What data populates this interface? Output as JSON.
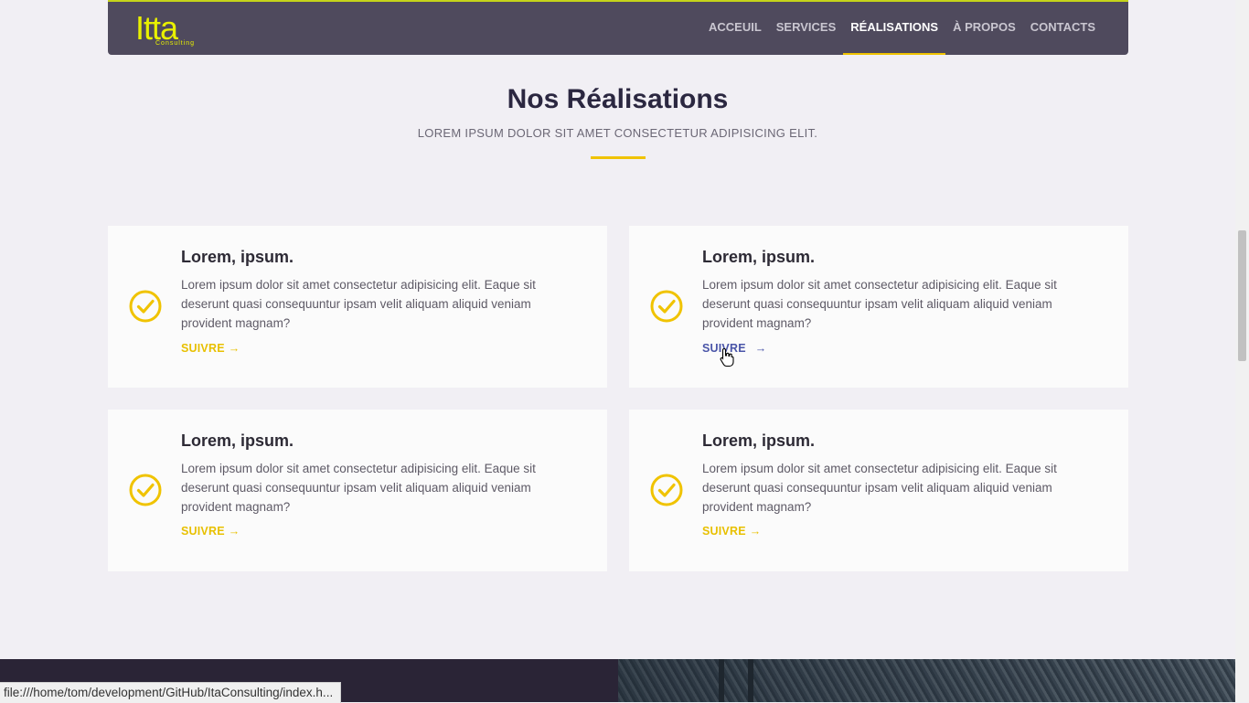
{
  "brand": {
    "logo_text": "Itta",
    "logo_sub": "Consulting"
  },
  "nav": {
    "items": [
      {
        "label": "ACCEUIL",
        "active": false
      },
      {
        "label": "SERVICES",
        "active": false
      },
      {
        "label": "RÉALISATIONS",
        "active": true
      },
      {
        "label": "À PROPOS",
        "active": false
      },
      {
        "label": "CONTACTS",
        "active": false
      }
    ]
  },
  "section": {
    "title": "Nos Réalisations",
    "subtitle": "LOREM IPSUM DOLOR SIT AMET CONSECTETUR ADIPISICING ELIT."
  },
  "cards": [
    {
      "title": "Lorem, ipsum.",
      "text": "Lorem ipsum dolor sit amet consectetur adipisicing elit. Eaque sit deserunt quasi consequuntur ipsam velit aliquam aliquid veniam provident magnam?",
      "link": "SUIVRE",
      "link_arrow": "→",
      "icon": "check-circle-icon"
    },
    {
      "title": "Lorem, ipsum.",
      "text": "Lorem ipsum dolor sit amet consectetur adipisicing elit. Eaque sit deserunt quasi consequuntur ipsam velit aliquam aliquid veniam provident magnam?",
      "link": "SUIVRE",
      "link_arrow": "→",
      "icon": "check-circle-icon",
      "hovered": true
    },
    {
      "title": "Lorem, ipsum.",
      "text": "Lorem ipsum dolor sit amet consectetur adipisicing elit. Eaque sit deserunt quasi consequuntur ipsam velit aliquam aliquid veniam provident magnam?",
      "link": "SUIVRE",
      "link_arrow": "→",
      "icon": "check-circle-icon"
    },
    {
      "title": "Lorem, ipsum.",
      "text": "Lorem ipsum dolor sit amet consectetur adipisicing elit. Eaque sit deserunt quasi consequuntur ipsam velit aliquam aliquid veniam provident magnam?",
      "link": "SUIVRE",
      "link_arrow": "→",
      "icon": "check-circle-icon"
    }
  ],
  "status_bar": {
    "url": "file:///home/tom/development/GitHub/ItaConsulting/index.h..."
  },
  "colors": {
    "accent": "#f0c300",
    "nav_bg": "#4f4a5d",
    "hover_link": "#4a55a8",
    "title": "#2b2740"
  }
}
